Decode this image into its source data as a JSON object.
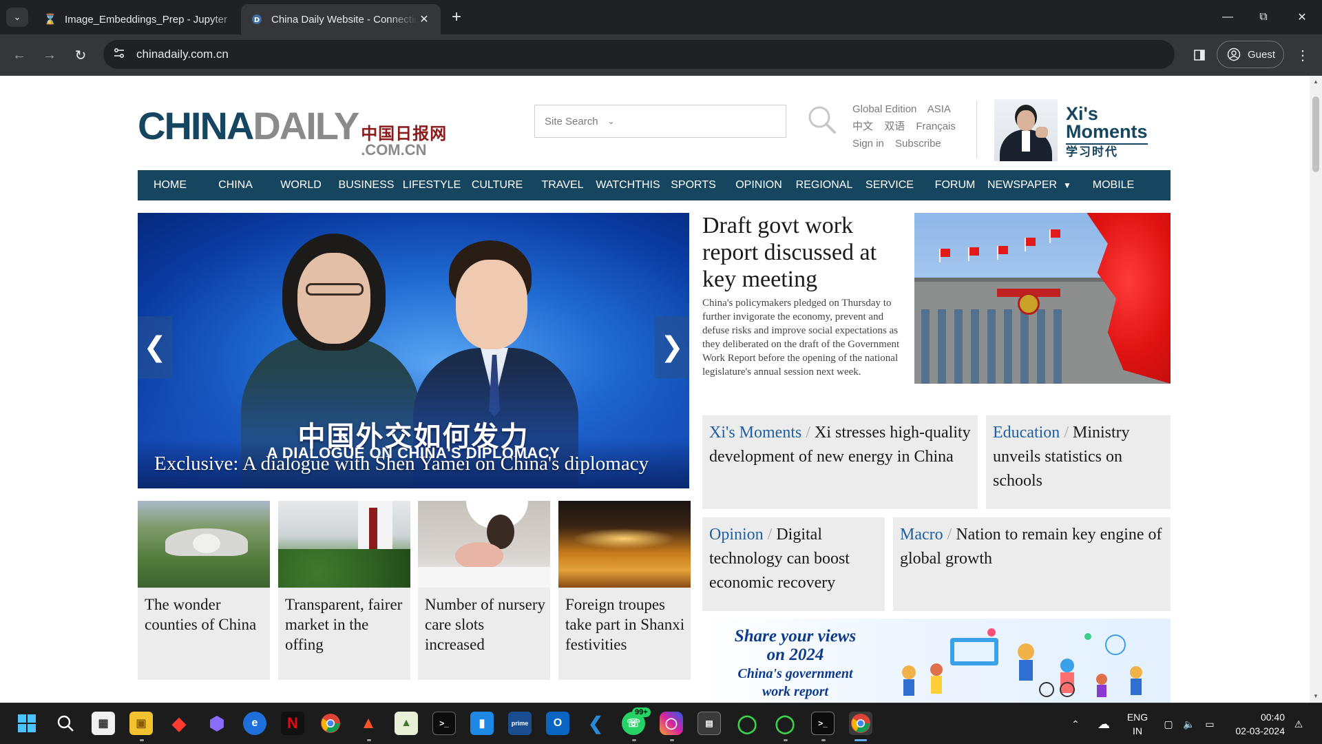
{
  "browser": {
    "tabs": [
      {
        "title": "Image_Embeddings_Prep - Jupyter",
        "active": false
      },
      {
        "title": "China Daily Website - Connecting China",
        "active": true
      }
    ],
    "url": "chinadaily.com.cn",
    "profile_label": "Guest"
  },
  "site": {
    "logo": {
      "china": "CHINA",
      "daily": "DAILY",
      "cn_name": "中国日报网",
      "domain": ".COM.CN"
    },
    "search": {
      "placeholder": "Site Search"
    },
    "header_links": {
      "row1": [
        "Global Edition",
        "ASIA"
      ],
      "row2": [
        "中文",
        "双语",
        "Français"
      ],
      "row3": [
        "Sign in",
        "Subscribe"
      ]
    },
    "xi_moments": {
      "title_line1": "Xi's",
      "title_line2": "Moments",
      "cn": "学习时代"
    },
    "nav": [
      "HOME",
      "CHINA",
      "WORLD",
      "BUSINESS",
      "LIFESTYLE",
      "CULTURE",
      "TRAVEL",
      "WATCHTHIS",
      "SPORTS",
      "OPINION",
      "REGIONAL",
      "SERVICE",
      "FORUM",
      "NEWSPAPER",
      "MOBILE"
    ],
    "hero": {
      "cn_title": "中国外交如何发力",
      "en_subtitle": "A DIALOGUE ON CHINA'S DIPLOMACY",
      "caption": "Exclusive: A dialogue with Shen Yamei on China's diplomacy"
    },
    "lead": {
      "title": "Draft govt work report discussed at key meeting",
      "body": "China's policymakers pledged on Thursday to further invigorate the economy, prevent and defuse risks and improve social expectations as they deliberated on the draft of the Government Work Report before the opening of the national legislature's annual session next week."
    },
    "headline_boxes": [
      {
        "tag": "Xi's Moments",
        "text": "Xi stresses high-quality development of new energy in China"
      },
      {
        "tag": "Education",
        "text": "Ministry unveils statistics on schools"
      },
      {
        "tag": "Opinion",
        "text": "Digital technology can boost economic recovery"
      },
      {
        "tag": "Macro",
        "text": "Nation to remain key engine of global growth"
      }
    ],
    "cards": [
      {
        "title": "The wonder counties of China"
      },
      {
        "title": "Transparent, fairer market in the offing"
      },
      {
        "title": "Number of nursery care slots increased"
      },
      {
        "title": "Foreign troupes take part in Shanxi festivities"
      }
    ],
    "banner": {
      "line1": "Share your views",
      "line2": "on 2024",
      "line3": "China's government",
      "line4": "work report"
    }
  },
  "taskbar": {
    "whatsapp_badge": "99+",
    "lang_line1": "ENG",
    "lang_line2": "IN",
    "time": "00:40",
    "date": "02-03-2024"
  },
  "colors": {
    "brand_navy": "#16465f",
    "link_blue": "#1f5fa3",
    "chrome_dark": "#202124",
    "chrome_toolbar": "#35363a"
  }
}
